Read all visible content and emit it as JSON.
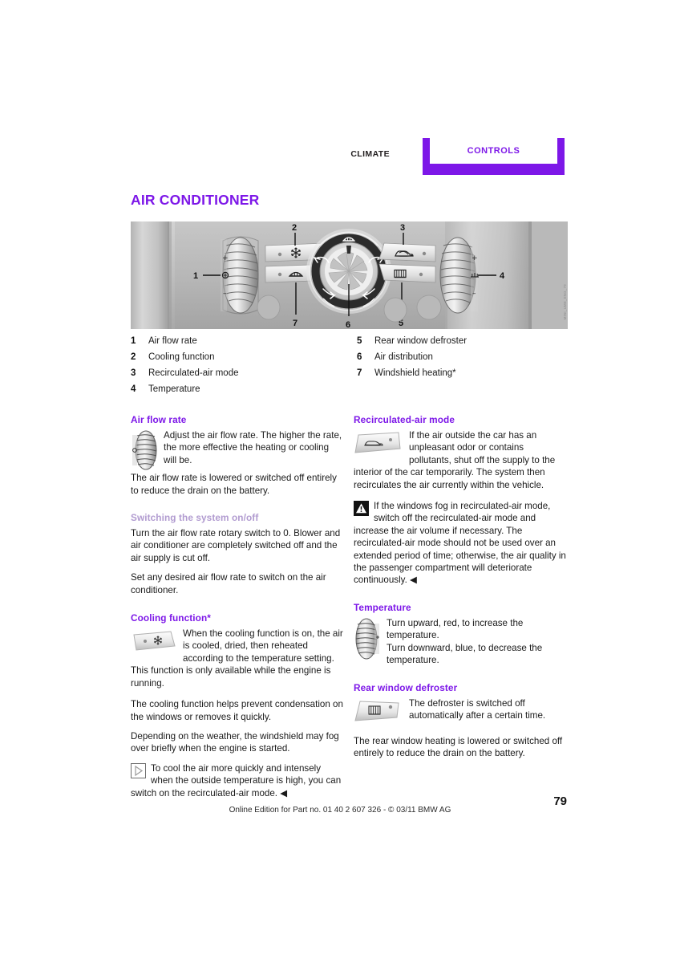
{
  "header": {
    "section_label": "CLIMATE",
    "tab_label": "CONTROLS",
    "accent_color": "#7d17e8"
  },
  "page_title": "AIR CONDITIONER",
  "figure": {
    "caption": "MINI_UME_ENG_79",
    "callouts": [
      "1",
      "2",
      "3",
      "4",
      "5",
      "6",
      "7"
    ]
  },
  "legend": {
    "left": [
      {
        "num": "1",
        "label": "Air flow rate"
      },
      {
        "num": "2",
        "label": "Cooling function"
      },
      {
        "num": "3",
        "label": "Recirculated-air mode"
      },
      {
        "num": "4",
        "label": "Temperature"
      }
    ],
    "right": [
      {
        "num": "5",
        "label": "Rear window defroster"
      },
      {
        "num": "6",
        "label": "Air distribution"
      },
      {
        "num": "7",
        "label": "Windshield heating*"
      }
    ]
  },
  "left_column": {
    "air_flow_rate": {
      "heading": "Air flow rate",
      "p1": "Adjust the air flow rate. The higher the rate, the more effective the heating or cooling will be.",
      "p2": "The air flow rate is lowered or switched off entirely to reduce the drain on the battery."
    },
    "switching": {
      "heading": "Switching the system on/off",
      "p1": "Turn the air flow rate rotary switch to 0. Blower and air conditioner are completely switched off and the air supply is cut off.",
      "p2": "Set any desired air flow rate to switch on the air conditioner."
    },
    "cooling": {
      "heading": "Cooling function*",
      "p1": "When the cooling function is on, the air is cooled, dried, then reheated according to the temperature setting. This function is only available while the engine is running.",
      "p2": "The cooling function helps prevent condensation on the windows or removes it quickly.",
      "p3": "Depending on the weather, the windshield may fog over briefly when the engine is started.",
      "note": "To cool the air more quickly and intensely when the outside temperature is high, you can switch on the recirculated-air mode. ◀"
    }
  },
  "right_column": {
    "recirculated": {
      "heading": "Recirculated-air mode",
      "p1": "If the air outside the car has an unpleasant odor or contains pollutants, shut off the supply to the interior of the car temporarily. The system then recirculates the air currently within the vehicle.",
      "warning": "If the windows fog in recirculated-air mode, switch off the recirculated-air mode and increase the air volume if necessary. The recirculated-air mode should not be used over an extended period of time; otherwise, the air quality in the passenger compartment will deteriorate continuously. ◀"
    },
    "temperature": {
      "heading": "Temperature",
      "p1": "Turn upward, red, to increase the temperature.",
      "p2": "Turn downward, blue, to decrease the temperature."
    },
    "defroster": {
      "heading": "Rear window defroster",
      "p1": "The defroster is switched off automatically after a certain time.",
      "p2": "The rear window heating is lowered or switched off entirely to reduce the drain on the battery."
    }
  },
  "footer": {
    "text": "Online Edition for Part no. 01 40 2 607 326 - © 03/11 BMW AG",
    "page_number": "79"
  }
}
